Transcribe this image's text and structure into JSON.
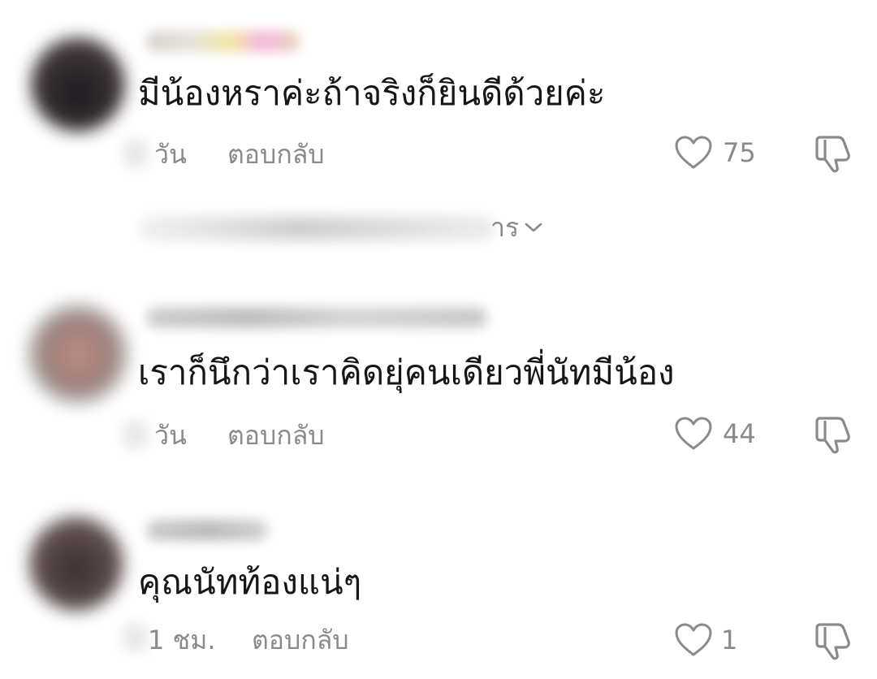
{
  "comments": [
    {
      "text": "มีน้องหราค่ะถ้าจริงก็ยินดีด้วยค่ะ",
      "time": "วัน",
      "reply_label": "ตอบกลับ",
      "likes": "75",
      "avatar_color": "#2a2527"
    },
    {
      "text": "เราก็นึกว่าเราคิดยุ่คนเดียวพี่นัทมีน้อง",
      "time": "วัน",
      "reply_label": "ตอบกลับ",
      "likes": "44",
      "avatar_color": "#8a7670"
    },
    {
      "text": "คุณนัทท้องแน่ๆ",
      "time": "1 ชม.",
      "reply_label": "ตอบกลับ",
      "likes": "1",
      "avatar_color": "#4a3e3e"
    }
  ],
  "view_replies": {
    "label": "าร"
  },
  "icons": {
    "like": "heart-outline-icon",
    "dislike": "thumbs-down-outline-icon",
    "expand": "chevron-down-icon"
  },
  "colors": {
    "text": "#161616",
    "meta": "#8a8a8a",
    "background": "#ffffff"
  }
}
